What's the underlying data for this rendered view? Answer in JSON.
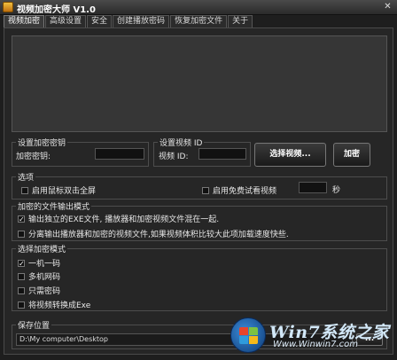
{
  "window": {
    "title": "视频加密大师 V1.0",
    "close_glyph": "✕"
  },
  "tabs": [
    {
      "label": "视频加密",
      "active": true
    },
    {
      "label": "高级设置",
      "active": false
    },
    {
      "label": "安全",
      "active": false
    },
    {
      "label": "创建播放密码",
      "active": false
    },
    {
      "label": "恢复加密文件",
      "active": false
    },
    {
      "label": "关于",
      "active": false
    }
  ],
  "encrypt_key": {
    "group_label": "设置加密密钥",
    "field_label": "加密密钥:",
    "value": ""
  },
  "video_id": {
    "group_label": "设置视频 ID",
    "field_label": "视频 ID:",
    "value": ""
  },
  "buttons": {
    "select_video": "选择视频...",
    "encrypt": "加密",
    "browse": "..."
  },
  "options": {
    "group_label": "选项",
    "mouse_double_click_fullscreen": {
      "label": "启用鼠标双击全屏",
      "checked": false
    },
    "free_trial": {
      "label": "启用免费试看视频",
      "checked": false,
      "seconds_value": "",
      "unit": "秒"
    }
  },
  "output_mode": {
    "group_label": "加密的文件输出模式",
    "items": [
      {
        "label": "输出独立的EXE文件, 播放器和加密视频文件混在一起.",
        "checked": true
      },
      {
        "label": "分离输出播放器和加密的视频文件,如果视频体积比较大此项加载速度快些.",
        "checked": false
      }
    ]
  },
  "encrypt_mode": {
    "group_label": "选择加密模式",
    "items": [
      {
        "label": "一机一码",
        "checked": true
      },
      {
        "label": "多机网码",
        "checked": false
      },
      {
        "label": "只需密码",
        "checked": false
      },
      {
        "label": "将视频转换成Exe",
        "checked": false
      }
    ]
  },
  "save_location": {
    "group_label": "保存位置",
    "path": "D:\\My computer\\Desktop"
  },
  "watermark": {
    "brand": "Win7系统之家",
    "url": "Www.Winwin7.com",
    "flag_colors": [
      "#e8452c",
      "#7cc242",
      "#2f9bdc",
      "#f6b91a"
    ]
  }
}
